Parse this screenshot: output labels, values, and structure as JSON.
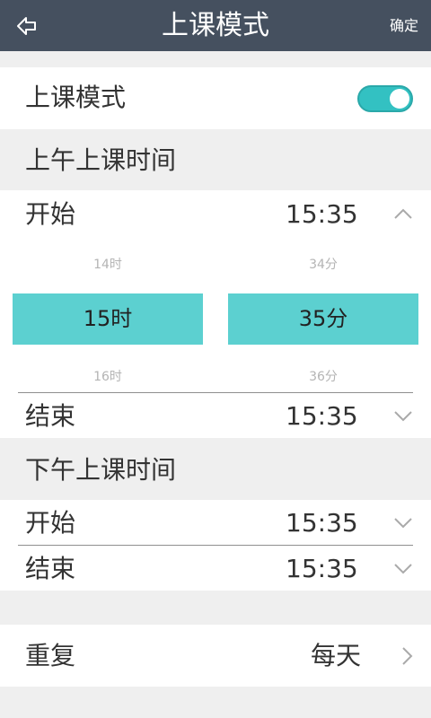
{
  "header": {
    "title": "上课模式",
    "confirm": "确定"
  },
  "class_mode": {
    "label": "上课模式",
    "enabled": true
  },
  "morning": {
    "section_title": "上午上课时间",
    "start": {
      "label": "开始",
      "time": "15:35",
      "expanded": true
    },
    "end": {
      "label": "结束",
      "time": "15:35",
      "expanded": false
    },
    "picker": {
      "hour_prev": "14时",
      "hour_selected": "15时",
      "hour_next": "16时",
      "minute_prev": "34分",
      "minute_selected": "35分",
      "minute_next": "36分"
    }
  },
  "afternoon": {
    "section_title": "下午上课时间",
    "start": {
      "label": "开始",
      "time": "15:35"
    },
    "end": {
      "label": "结束",
      "time": "15:35"
    }
  },
  "repeat": {
    "label": "重复",
    "value": "每天"
  },
  "colors": {
    "header_bg": "#45505f",
    "accent": "#33c1c2",
    "picker_selected": "#5cd0d0",
    "page_bg": "#efefef"
  }
}
